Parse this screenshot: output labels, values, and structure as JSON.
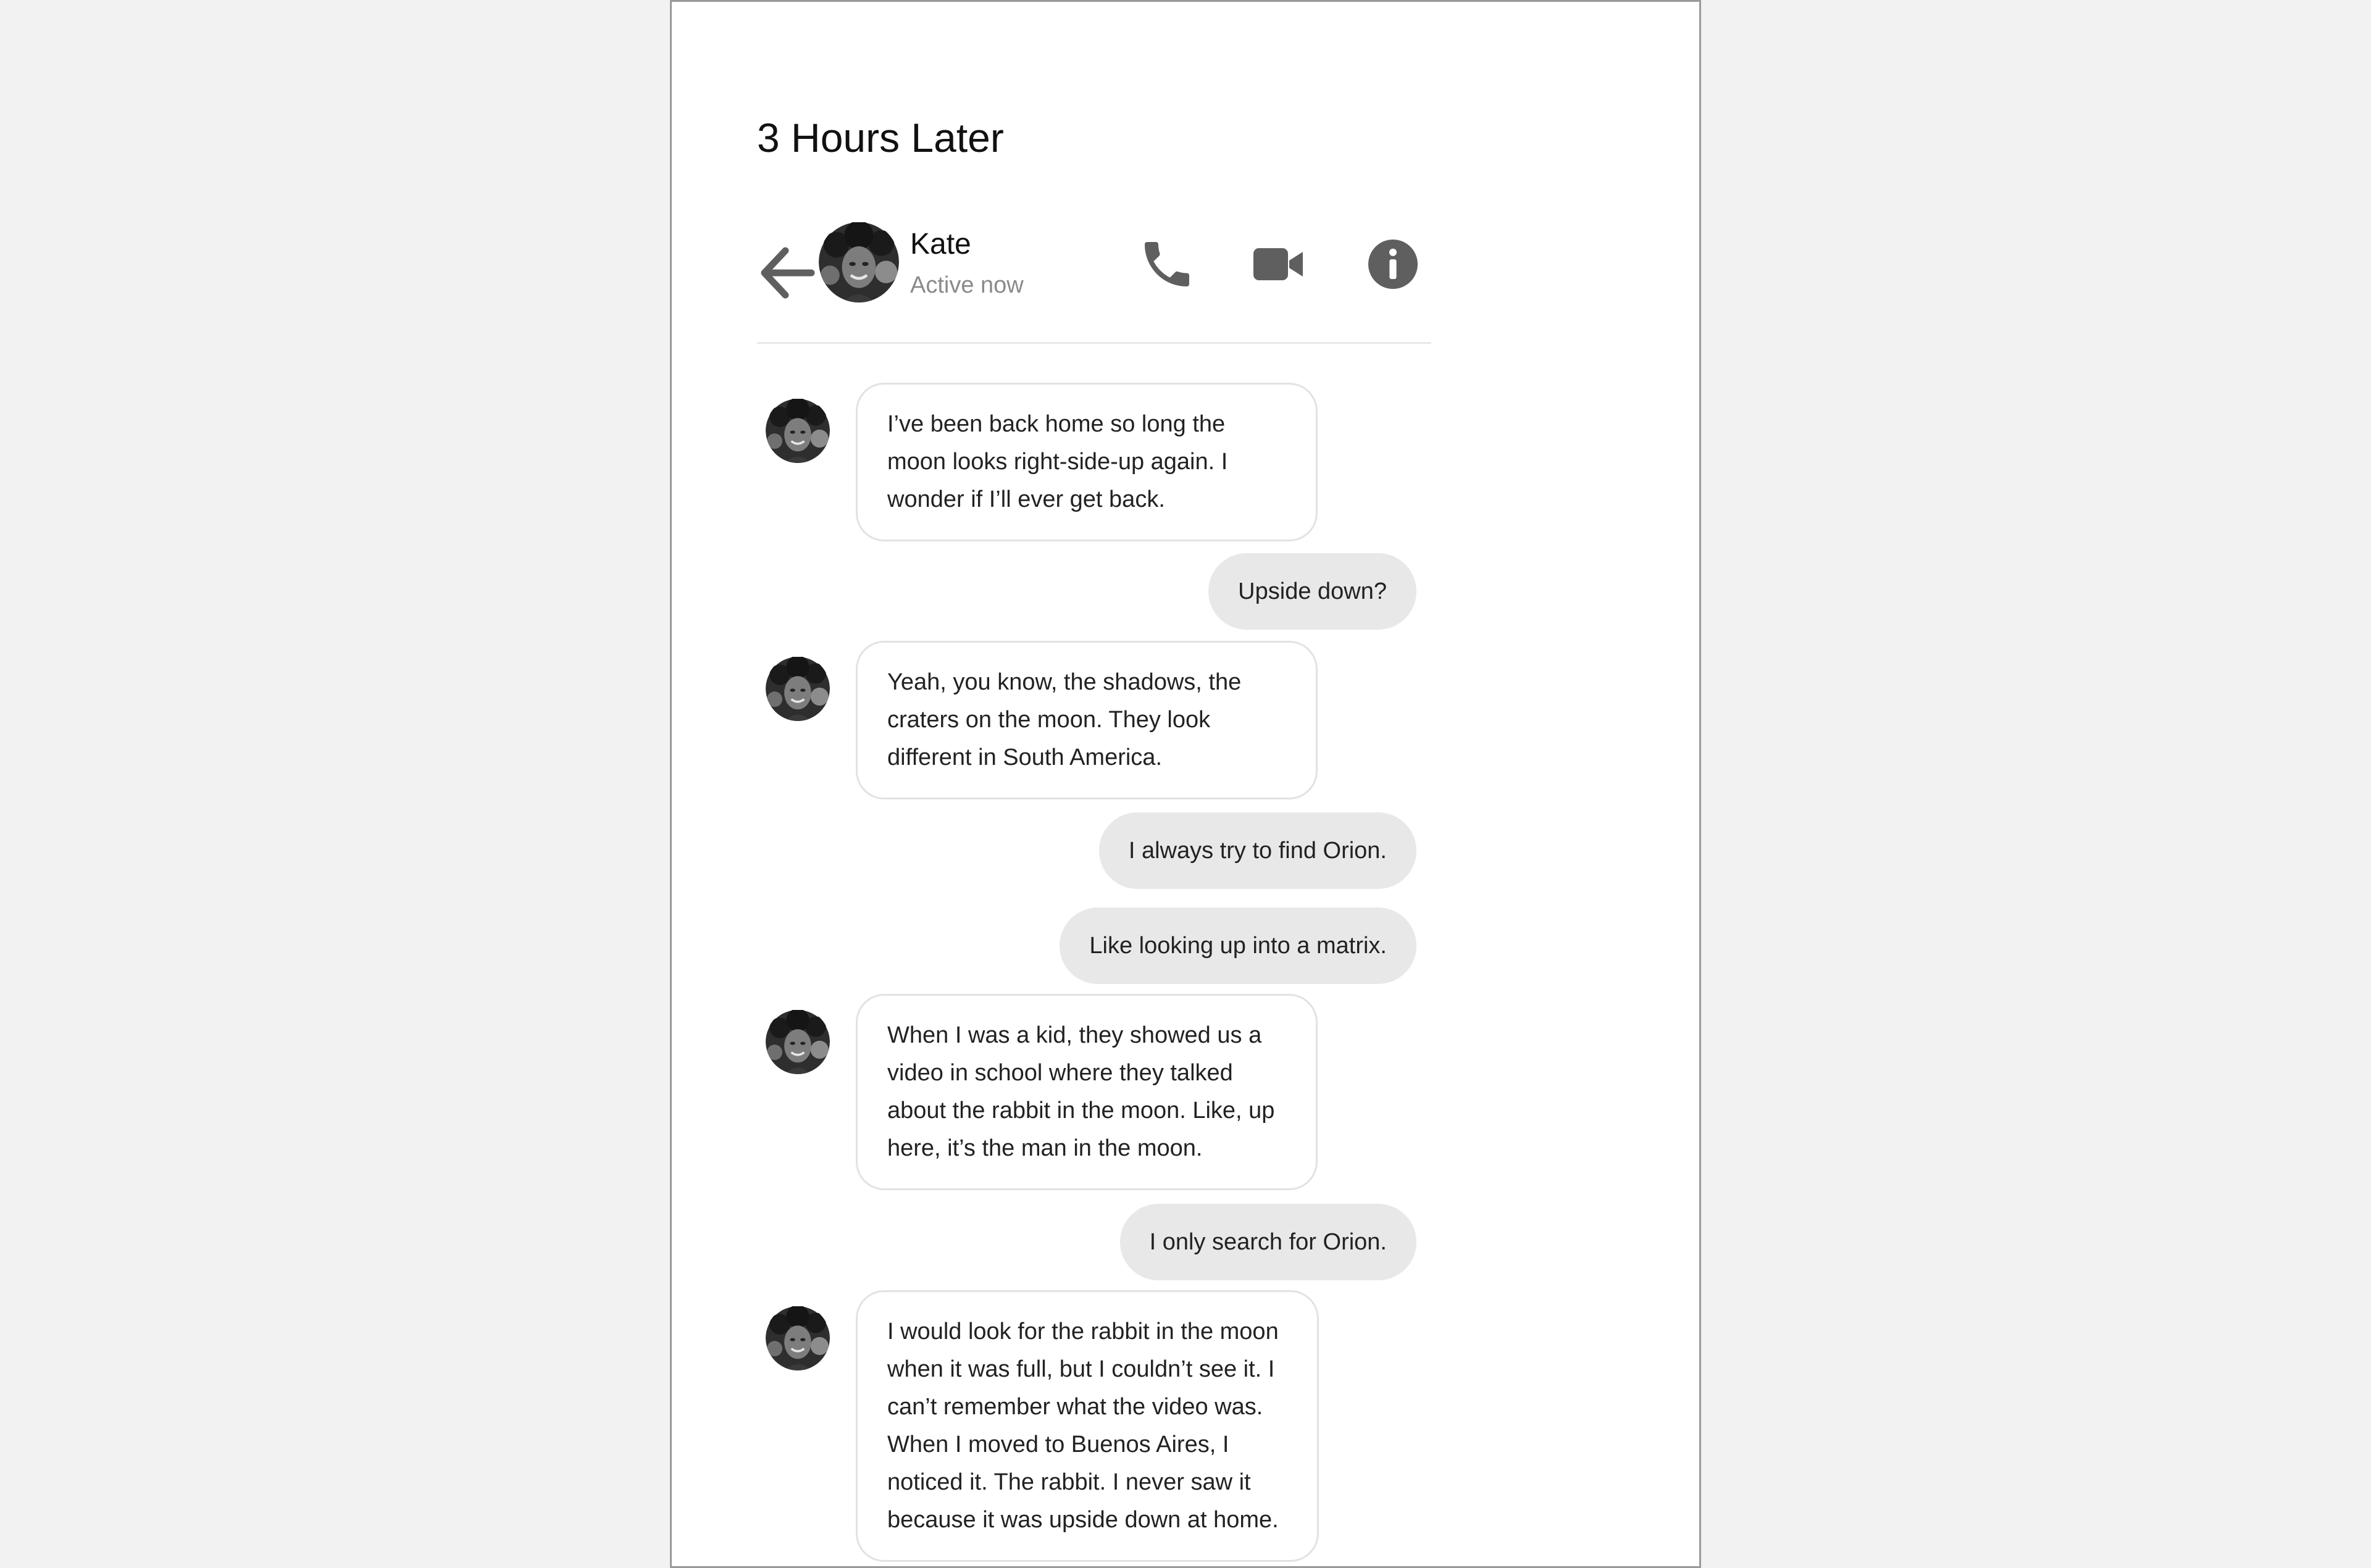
{
  "scene": {
    "title": "3 Hours Later"
  },
  "header": {
    "contact_name": "Kate",
    "status": "Active now",
    "icons": [
      "back-arrow-icon",
      "avatar",
      "phone-icon",
      "video-camera-icon",
      "info-icon"
    ]
  },
  "messages": [
    {
      "sender": "Kate",
      "direction": "incoming",
      "text": "I’ve been back home so long the moon looks right-side-up again. I wonder if I’ll ever get back."
    },
    {
      "direction": "outgoing",
      "text": "Upside down?"
    },
    {
      "sender": "Kate",
      "direction": "incoming",
      "text": "Yeah, you know, the shadows, the craters on the moon. They look different in South America."
    },
    {
      "direction": "outgoing",
      "text": "I always try to find Orion."
    },
    {
      "direction": "outgoing",
      "text": "Like looking up into a matrix."
    },
    {
      "sender": "Kate",
      "direction": "incoming",
      "text": "When I was a kid, they showed us a video in school where they talked about the rabbit in the moon. Like, up here, it’s the man in the moon."
    },
    {
      "direction": "outgoing",
      "text": "I only search for Orion."
    },
    {
      "sender": "Kate",
      "direction": "incoming",
      "text": "I would look for the rabbit in the moon when it was full, but I couldn’t see it. I can’t remember what the video was. When I moved to Buenos Aires, I noticed it. The rabbit. I never saw it because it was upside down at home."
    }
  ],
  "colors": {
    "page_background": "#f2f2f2",
    "paper": "#ffffff",
    "outgoing_bubble": "#e8e8e8",
    "incoming_border": "#e2e2e2",
    "icon": "#5f5f5f",
    "status_text": "#8a8a8a"
  }
}
